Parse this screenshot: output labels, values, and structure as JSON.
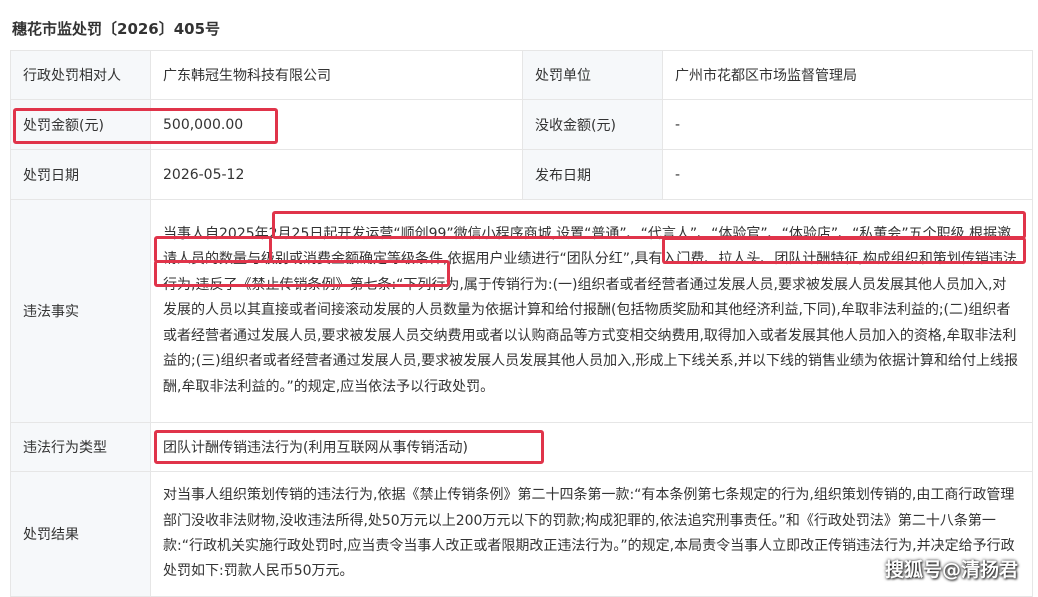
{
  "document": {
    "title": "穗花市监处罚〔2026〕405号"
  },
  "rows": {
    "party": {
      "label": "行政处罚相对人",
      "value": "广东韩冠生物科技有限公司"
    },
    "unit": {
      "label": "处罚单位",
      "value": "广州市花都区市场监督管理局"
    },
    "amount": {
      "label": "处罚金额(元)",
      "value": "500,000.00"
    },
    "confiscated": {
      "label": "没收金额(元)",
      "value": "-"
    },
    "date": {
      "label": "处罚日期",
      "value": "2026-05-12"
    },
    "publish": {
      "label": "发布日期",
      "value": "-"
    },
    "facts": {
      "label": "违法事实",
      "value": "当事人自2025年2月25日起开发运营“顺创99”微信小程序商城,设置“普通”、“代言人”、“体验官”、“体验店”、“私董会”五个职级,根据邀请人员的数量与级别或消费金额确定等级条件,依据用户业绩进行“团队分红”,具有入门费、拉人头、团队计酬特征,构成组织和策划传销违法行为,违反了《禁止传销条例》第七条:“下列行为,属于传销行为:(一)组织者或者经营者通过发展人员,要求被发展人员发展其他人员加入,对发展的人员以其直接或者间接滚动发展的人员数量为依据计算和给付报酬(包括物质奖励和其他经济利益,下同),牟取非法利益的;(二)组织者或者经营者通过发展人员,要求被发展人员交纳费用或者以认购商品等方式变相交纳费用,取得加入或者发展其他人员加入的资格,牟取非法利益的;(三)组织者或者经营者通过发展人员,要求被发展人员发展其他人员加入,形成上下线关系,并以下线的销售业绩为依据计算和给付上线报酬,牟取非法利益的。”的规定,应当依法予以行政处罚。"
    },
    "type": {
      "label": "违法行为类型",
      "value": "团队计酬传销违法行为(利用互联网从事传销活动)"
    },
    "result": {
      "label": "处罚结果",
      "value": "对当事人组织策划传销的违法行为,依据《禁止传销条例》第二十四条第一款:“有本条例第七条规定的行为,组织策划传销的,由工商行政管理部门没收非法财物,没收违法所得,处50万元以上200万元以下的罚款;构成犯罪的,依法追究刑事责任。”和《行政处罚法》第二十八条第一款:“行政机关实施行政处罚时,应当责令当事人改正或者限期改正违法行为。”的规定,本局责令当事人立即改正传销违法行为,并决定给予行政处罚如下:罚款人民币50万元。"
    }
  },
  "watermark": "搜狐号@清扬君",
  "colors": {
    "highlight_border": "#e0344a",
    "label_bg": "#f6f8fa",
    "link": "#2b6fd1"
  }
}
